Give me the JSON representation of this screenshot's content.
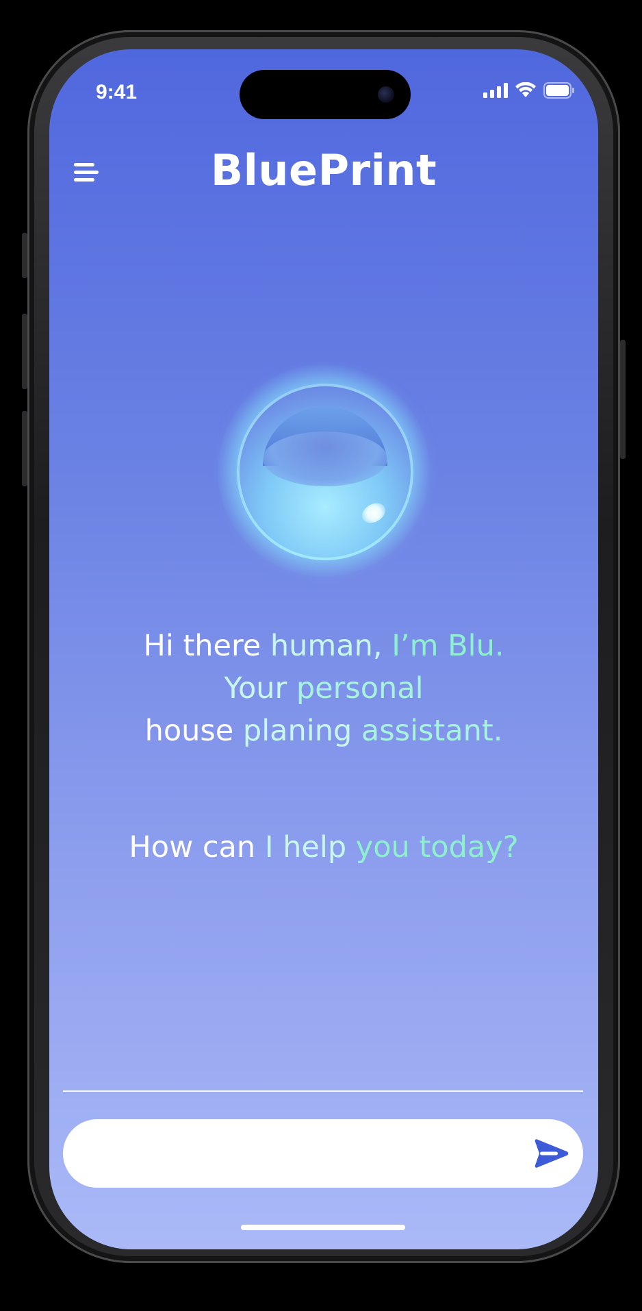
{
  "status_bar": {
    "time": "9:41"
  },
  "header": {
    "title": "BluePrint"
  },
  "greeting": {
    "line1": [
      {
        "text": "Hi there ",
        "tone": "w"
      },
      {
        "text": "human, ",
        "tone": "c1"
      },
      {
        "text": "I’m Blu.",
        "tone": "c3"
      }
    ],
    "line2": [
      {
        "text": "Your ",
        "tone": "c1"
      },
      {
        "text": "personal",
        "tone": "c2"
      }
    ],
    "line3": [
      {
        "text": "house ",
        "tone": "w"
      },
      {
        "text": "planing ",
        "tone": "c1"
      },
      {
        "text": "assistant.",
        "tone": "c2"
      }
    ],
    "prompt": [
      {
        "text": "How can ",
        "tone": "w"
      },
      {
        "text": "I help ",
        "tone": "c1"
      },
      {
        "text": "you today?",
        "tone": "c3"
      }
    ]
  },
  "composer": {
    "placeholder": "",
    "value": ""
  },
  "colors": {
    "background_top": "#5068de",
    "background_bottom": "#aab9f7",
    "accent_mint": "#8ef0cf",
    "send_icon": "#3d5bd6"
  },
  "icons": {
    "menu": "menu-icon",
    "send": "send-icon",
    "signal": "cellular-signal-icon",
    "wifi": "wifi-icon",
    "battery": "battery-icon"
  }
}
